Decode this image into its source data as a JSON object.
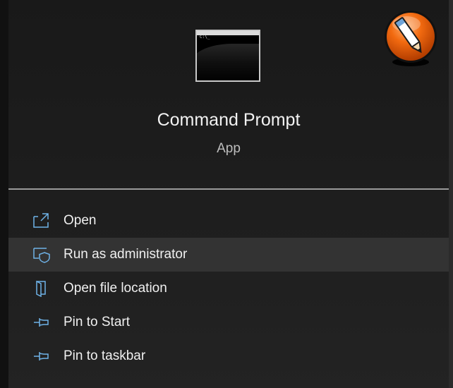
{
  "app": {
    "name": "Command Prompt",
    "type": "App",
    "icon": "command-prompt-icon",
    "icon_prompt_text": "C:\\_"
  },
  "menu": {
    "items": [
      {
        "label": "Open",
        "icon": "open-icon",
        "hovered": false
      },
      {
        "label": "Run as administrator",
        "icon": "shield-icon",
        "hovered": true
      },
      {
        "label": "Open file location",
        "icon": "folder-icon",
        "hovered": false
      },
      {
        "label": "Pin to Start",
        "icon": "pin-icon",
        "hovered": false
      },
      {
        "label": "Pin to taskbar",
        "icon": "pin-icon",
        "hovered": false
      }
    ]
  },
  "colors": {
    "accent": "#6fb3e8",
    "background": "#1d1d1d",
    "hover": "#333333",
    "logo_orange": "#f26a10"
  },
  "overlay": {
    "icon": "pencil-badge-icon"
  }
}
